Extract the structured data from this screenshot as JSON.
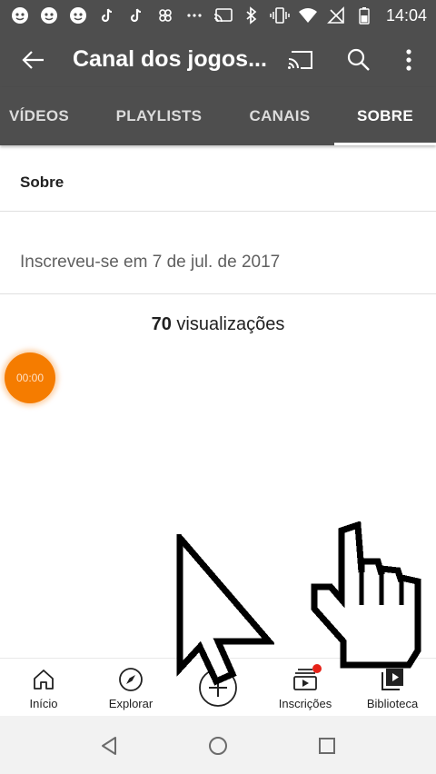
{
  "status_bar": {
    "left_icons": [
      "face-icon",
      "face-icon",
      "face-icon",
      "tiktok-icon",
      "tiktok-icon",
      "app-icon",
      "more-notifications-icon"
    ],
    "time": "14:04"
  },
  "app_bar": {
    "title": "Canal dos jogos..."
  },
  "tabs": [
    {
      "label": "VÍDEOS"
    },
    {
      "label": "PLAYLISTS"
    },
    {
      "label": "CANAIS"
    },
    {
      "label": "SOBRE"
    }
  ],
  "about": {
    "section_title": "Sobre",
    "joined": "Inscreveu-se em 7 de jul. de 2017",
    "views_count": "70",
    "views_label": " visualizações"
  },
  "timer": {
    "text": "00:00",
    "color": "#f57c00"
  },
  "bottom_nav": [
    {
      "label": "Início"
    },
    {
      "label": "Explorar"
    },
    {
      "label": ""
    },
    {
      "label": "Inscrições"
    },
    {
      "label": "Biblioteca"
    }
  ],
  "colors": {
    "header_bg": "#4e4e4e",
    "notification_dot": "#e62117"
  }
}
